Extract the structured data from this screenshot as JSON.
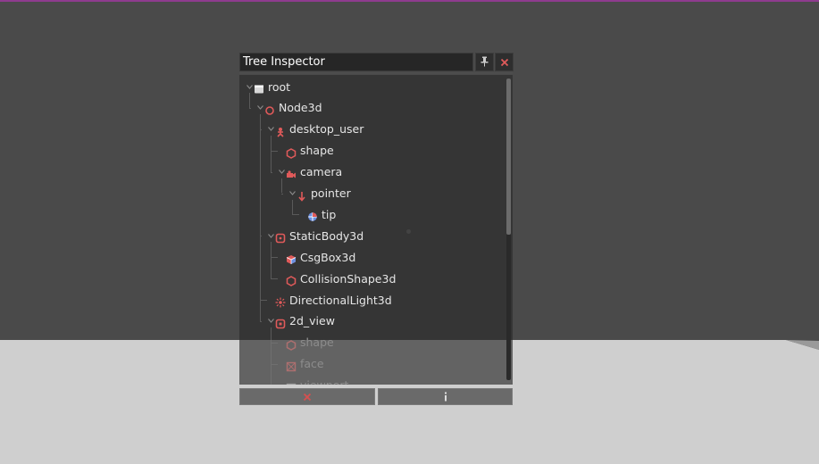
{
  "colors": {
    "accent_red": "#e05a5a",
    "icon_blue": "#6b8fe0",
    "panel_bg": "#333333",
    "sky": "#4a4a4a",
    "floor": "#cfcfcf"
  },
  "window": {
    "title": "Tree Inspector",
    "pin_icon": "pin-icon",
    "close_icon": "close-icon"
  },
  "tree": {
    "nodes": [
      {
        "label": "root",
        "icon": "root-window-icon",
        "depth": 0,
        "expanded": true
      },
      {
        "label": "Node3d",
        "icon": "node3d-icon",
        "depth": 1,
        "expanded": true
      },
      {
        "label": "desktop_user",
        "icon": "desktop-user-icon",
        "depth": 2,
        "expanded": true
      },
      {
        "label": "shape",
        "icon": "shape-icon",
        "depth": 3,
        "expanded": false
      },
      {
        "label": "camera",
        "icon": "camera-icon",
        "depth": 3,
        "expanded": true
      },
      {
        "label": "pointer",
        "icon": "pointer-arrow-icon",
        "depth": 4,
        "expanded": true
      },
      {
        "label": "tip",
        "icon": "tip-sphere-icon",
        "depth": 5,
        "expanded": false
      },
      {
        "label": "StaticBody3d",
        "icon": "static-body-icon",
        "depth": 2,
        "expanded": true
      },
      {
        "label": "CsgBox3d",
        "icon": "csg-box-icon",
        "depth": 3,
        "expanded": false
      },
      {
        "label": "CollisionShape3d",
        "icon": "collision-shape-icon",
        "depth": 3,
        "expanded": false
      },
      {
        "label": "DirectionalLight3d",
        "icon": "directional-light-icon",
        "depth": 2,
        "expanded": false
      },
      {
        "label": "2d_view",
        "icon": "view-2d-icon",
        "depth": 2,
        "expanded": true
      },
      {
        "label": "shape",
        "icon": "shape-icon",
        "depth": 3,
        "expanded": false
      },
      {
        "label": "face",
        "icon": "face-icon",
        "depth": 3,
        "expanded": false
      },
      {
        "label": "viewport",
        "icon": "viewport-icon",
        "depth": 3,
        "expanded": false
      }
    ]
  },
  "buttons": {
    "close_icon": "close-icon",
    "info_icon": "info-icon"
  }
}
